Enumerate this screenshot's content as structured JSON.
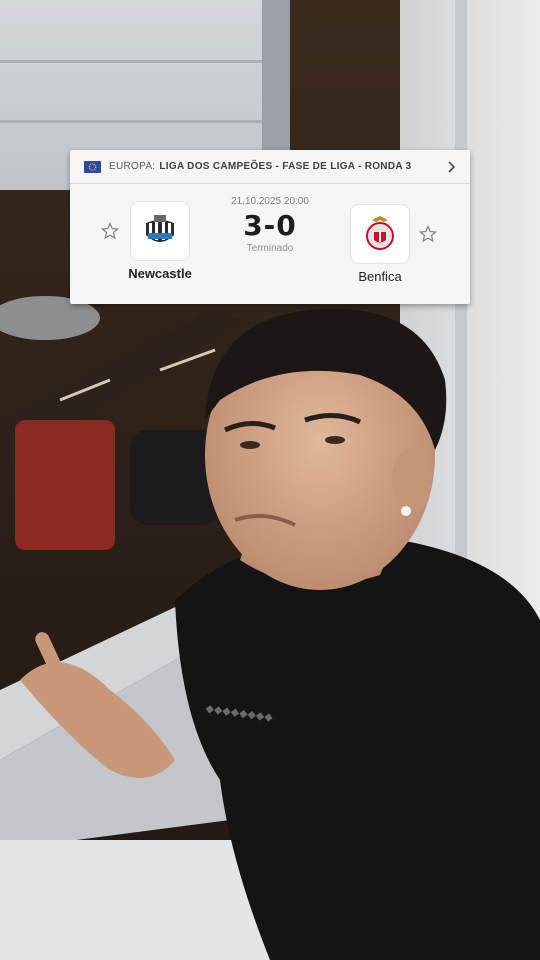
{
  "match_card": {
    "region": "EUROPA:",
    "competition": "LIGA DOS CAMPEÕES - FASE DE LIGA - RONDA 3",
    "datetime": "21.10.2025 20:00",
    "score": "3-0",
    "status": "Terminado",
    "home_team": "Newcastle",
    "away_team": "Benfica",
    "accent_color": "#1c1e21"
  },
  "icons": [
    "flag-icon",
    "chevron-right-icon",
    "star-icon",
    "newcastle-crest-icon",
    "benfica-crest-icon"
  ]
}
